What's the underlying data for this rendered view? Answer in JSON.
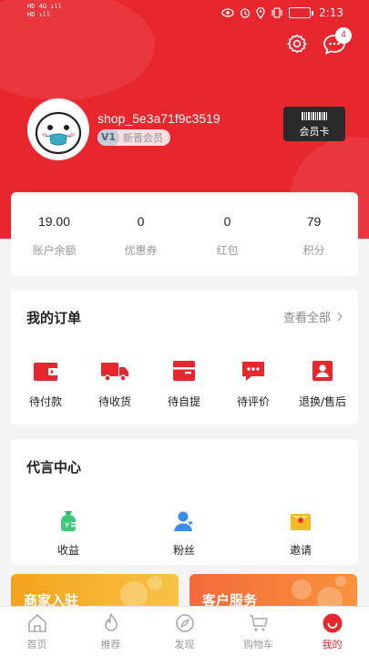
{
  "status_bar": {
    "left_line1": "HD 4G ıll",
    "left_line2": "HD ıll",
    "battery": "",
    "time": "2:13"
  },
  "header": {
    "message_badge": "4",
    "username": "shop_5e3a71f9c3519",
    "level_badge": "V1",
    "level_name": "新晋会员",
    "vip_card_label": "会员卡",
    "accent_color": "#e8262d"
  },
  "stats": [
    {
      "value": "19.00",
      "label": "账户余额"
    },
    {
      "value": "0",
      "label": "优惠券"
    },
    {
      "value": "0",
      "label": "红包"
    },
    {
      "value": "79",
      "label": "积分"
    }
  ],
  "orders": {
    "title": "我的订单",
    "see_all": "查看全部",
    "items": [
      {
        "label": "待付款",
        "icon": "wallet-icon"
      },
      {
        "label": "待收货",
        "icon": "truck-icon"
      },
      {
        "label": "待自提",
        "icon": "box-icon"
      },
      {
        "label": "待评价",
        "icon": "comment-icon"
      },
      {
        "label": "退换/售后",
        "icon": "badge-icon"
      }
    ]
  },
  "spokes": {
    "title": "代言中心",
    "items": [
      {
        "label": "收益",
        "icon": "money-bag-icon"
      },
      {
        "label": "粉丝",
        "icon": "fans-icon"
      },
      {
        "label": "邀请",
        "icon": "invite-envelope-icon"
      }
    ]
  },
  "banners": [
    {
      "label": "商家入驻"
    },
    {
      "label": "客户服务"
    }
  ],
  "tabbar": [
    {
      "label": "首页",
      "icon": "home-icon"
    },
    {
      "label": "推荐",
      "icon": "flame-icon"
    },
    {
      "label": "发现",
      "icon": "compass-icon"
    },
    {
      "label": "购物车",
      "icon": "cart-icon"
    },
    {
      "label": "我的",
      "icon": "profile-icon",
      "active": true
    }
  ]
}
